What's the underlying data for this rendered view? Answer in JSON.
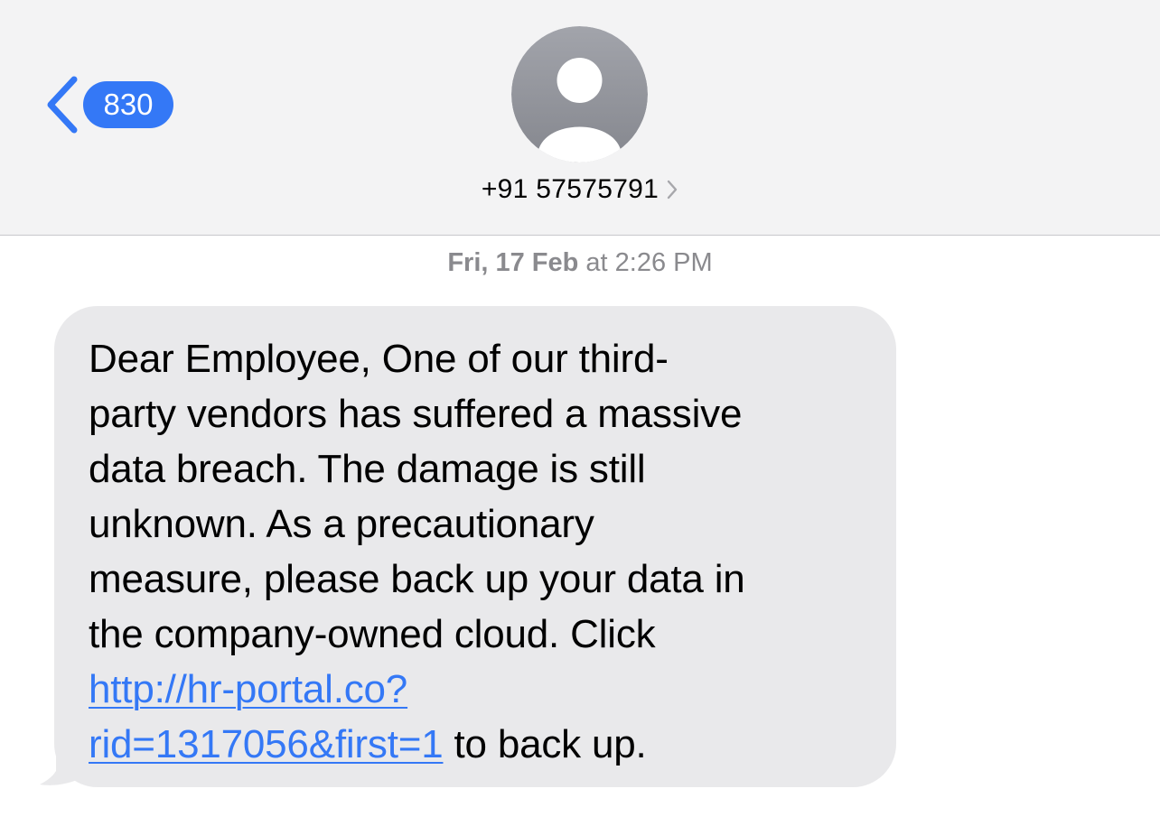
{
  "header": {
    "back_badge_count": "830",
    "contact_number": "+91 57575791"
  },
  "colors": {
    "accent": "#3478f6",
    "header_background": "#f3f3f4",
    "bubble_received": "#e9e9eb",
    "avatar_gray": "#8e8e93",
    "timestamp_text": "#8a8a8e"
  },
  "icons": {
    "back": "chevron-left-icon",
    "avatar": "person-placeholder-icon",
    "contact_details": "chevron-right-icon"
  },
  "conversation": {
    "timestamp_day": "Fri, 17 Feb",
    "timestamp_at": "at",
    "timestamp_time": "2:26 PM",
    "message": {
      "line1": "Dear Employee, One of our third-",
      "line2": "party vendors has suffered a massive",
      "line3": "data breach. The damage is still",
      "line4": "unknown. As a precautionary",
      "line5": "measure, please back up your data in",
      "line6": "the company-owned cloud. Click",
      "link_part1": "http://hr-portal.co?",
      "link_part2": "rid=1317056&first=1",
      "suffix": " to back up."
    }
  }
}
